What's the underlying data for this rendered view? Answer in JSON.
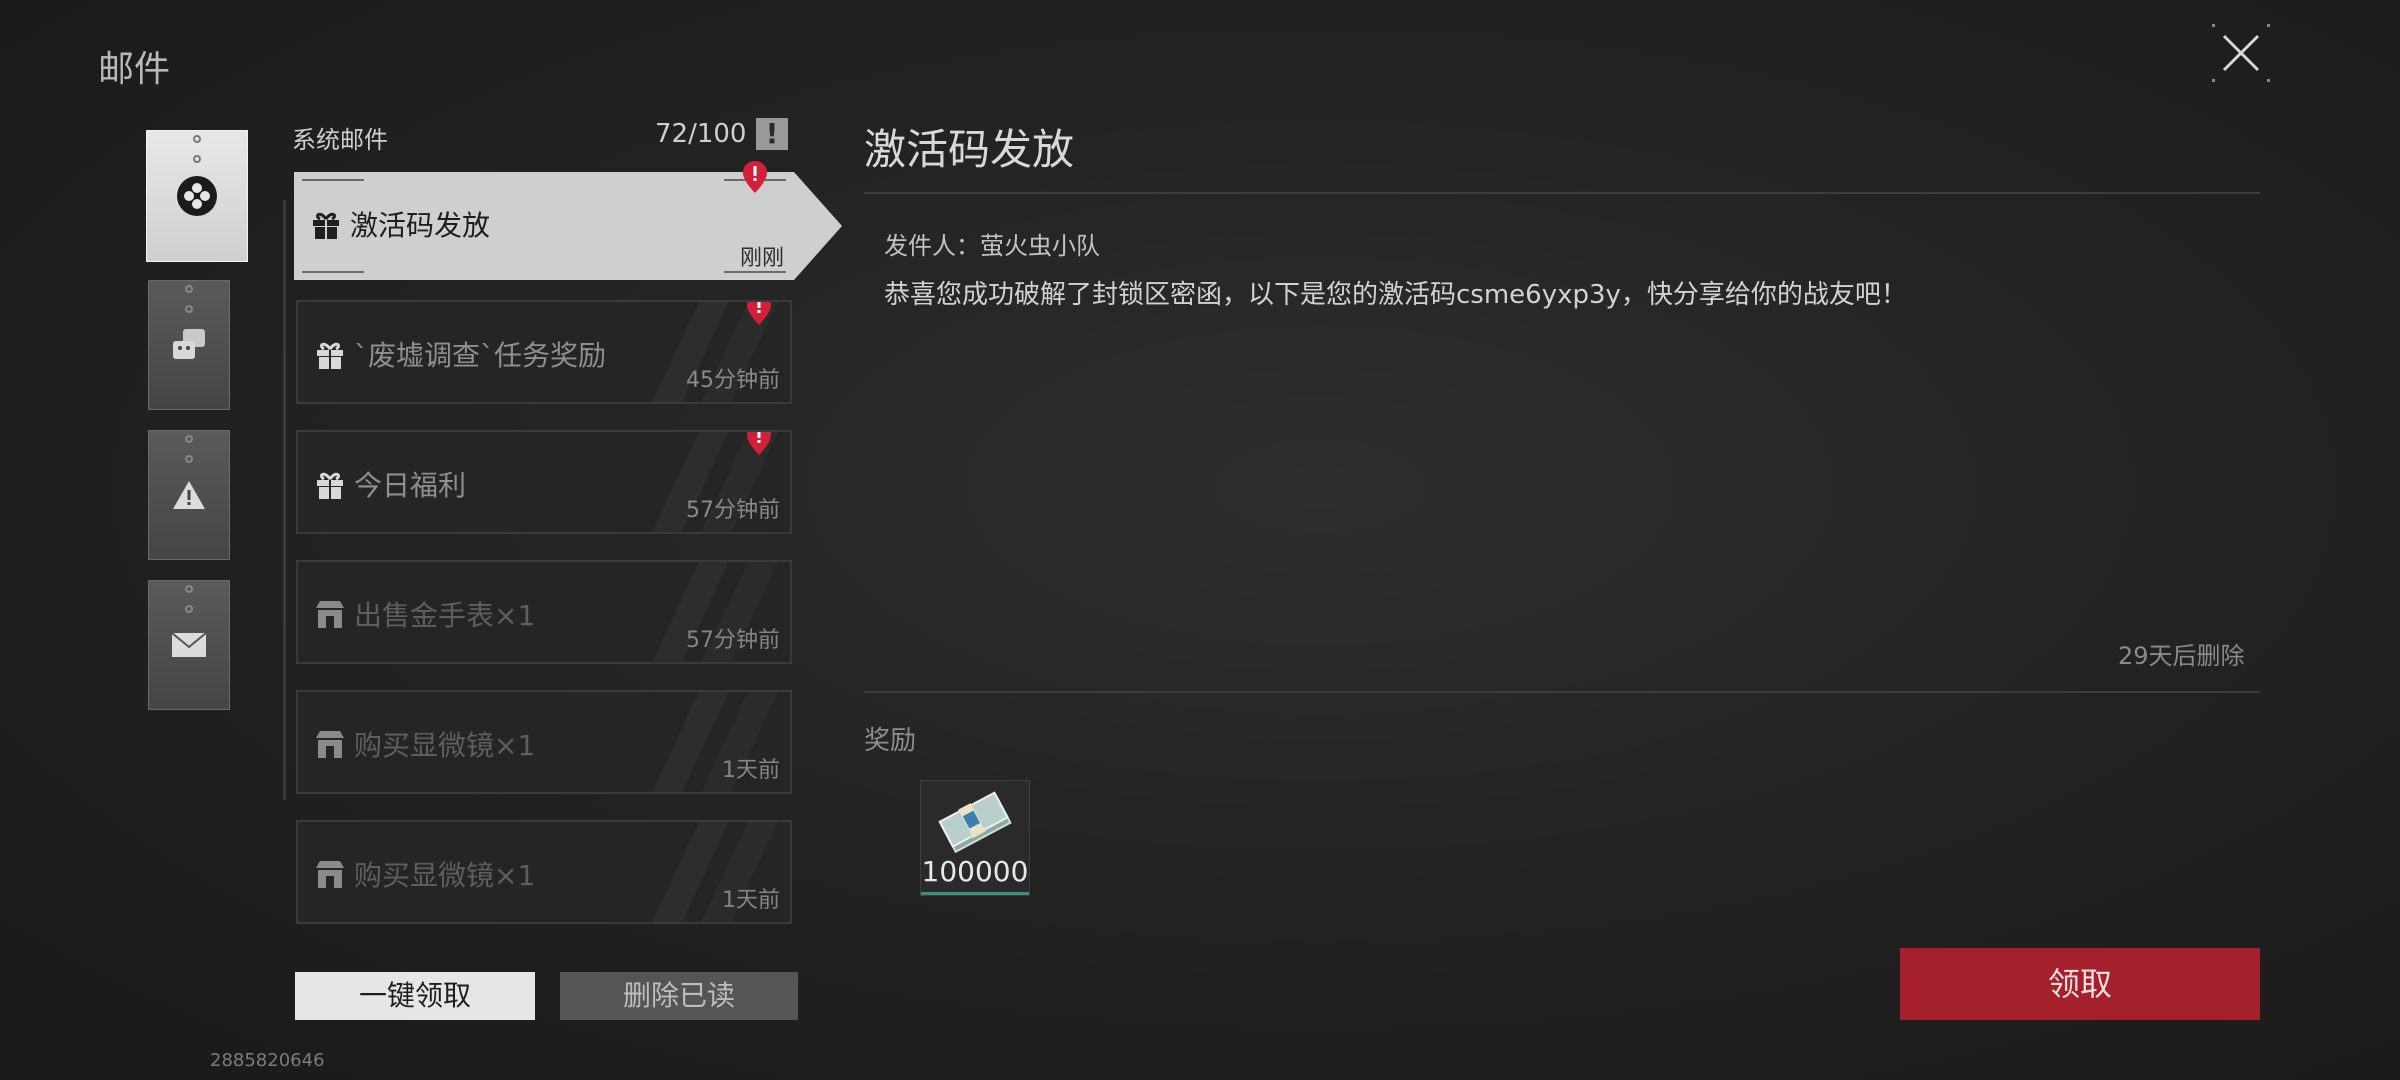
{
  "page_title": "邮件",
  "list": {
    "header_title": "系统邮件",
    "count": "72/100",
    "items": [
      {
        "title": "激活码发放",
        "time": "刚刚",
        "icon": "gift-icon",
        "unread": true,
        "active": true
      },
      {
        "title": "`废墟调查`任务奖励",
        "time": "45分钟前",
        "icon": "gift-icon",
        "unread": true
      },
      {
        "title": "今日福利",
        "time": "57分钟前",
        "icon": "gift-icon",
        "unread": true
      },
      {
        "title": "出售金手表×1",
        "time": "57分钟前",
        "icon": "shop-icon",
        "unread": false
      },
      {
        "title": "购买显微镜×1",
        "time": "1天前",
        "icon": "shop-icon",
        "unread": false
      },
      {
        "title": "购买显微镜×1",
        "time": "1天前",
        "icon": "shop-icon",
        "unread": false
      }
    ]
  },
  "buttons": {
    "claim_all": "一键领取",
    "delete_read": "删除已读",
    "claim": "领取"
  },
  "uid": "2885820646",
  "detail": {
    "title": "激活码发放",
    "sender": "发件人：萤火虫小队",
    "body": "恭喜您成功破解了封锁区密函，以下是您的激活码csme6yxp3y，快分享给你的战友吧！",
    "expire": "29天后删除",
    "reward_label": "奖励",
    "reward_amount": "100000"
  },
  "colors": {
    "accent_red": "#a5202c",
    "unread_badge": "#d21f3a"
  }
}
